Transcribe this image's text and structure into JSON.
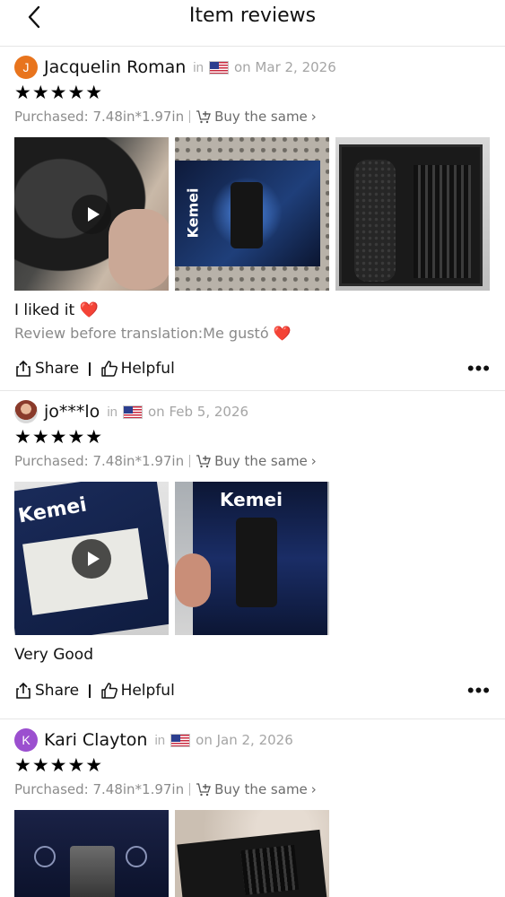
{
  "header": {
    "title": "Item reviews"
  },
  "reviews": [
    {
      "initial": "J",
      "avatar_color": "#e8741d",
      "name": "Jacquelin Roman",
      "in_label": "in",
      "date": "on Mar 2, 2026",
      "stars": "★★★★★",
      "purchased": "Purchased: 7.48in*1.97in",
      "buy_same": "Buy the same",
      "text": "I liked it",
      "original": "Review before translation:Me gustó",
      "share": "Share",
      "helpful": "Helpful",
      "more": "•••"
    },
    {
      "initial": "",
      "name": "jo***lo",
      "in_label": "in",
      "date": "on Feb 5, 2026",
      "stars": "★★★★★",
      "purchased": "Purchased: 7.48in*1.97in",
      "buy_same": "Buy the same",
      "text": "Very Good",
      "share": "Share",
      "helpful": "Helpful",
      "more": "•••"
    },
    {
      "initial": "K",
      "avatar_color": "#9b4fcf",
      "name": "Kari Clayton",
      "in_label": "in",
      "date": "on Jan 2, 2026",
      "stars": "★★★★★",
      "purchased": "Purchased: 7.48in*1.97in",
      "buy_same": "Buy the same"
    }
  ],
  "box_brand": "Kemei",
  "heart": "❤️"
}
